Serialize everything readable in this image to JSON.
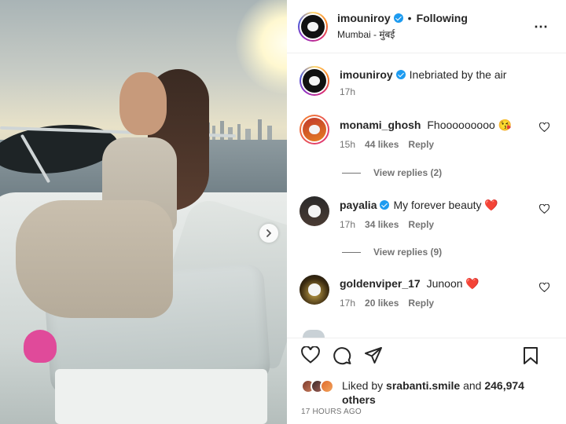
{
  "post": {
    "username": "imouniroy",
    "follow_status": "Following",
    "separator": "•",
    "location": "Mumbai - मुंबई",
    "more_icon": "⋯"
  },
  "caption": {
    "username": "imouniroy",
    "text": "Inebriated by the air",
    "time": "17h"
  },
  "comments": [
    {
      "username": "monami_ghosh",
      "text": "Fhooooooooo 😘",
      "time": "15h",
      "likes": "44 likes",
      "reply_label": "Reply",
      "view_replies": "View replies (2)"
    },
    {
      "username": "payalia",
      "text": "My forever beauty ❤️",
      "time": "17h",
      "likes": "34 likes",
      "reply_label": "Reply",
      "view_replies": "View replies (9)"
    },
    {
      "username": "goldenviper_17",
      "text": "Junoon ❤️",
      "time": "17h",
      "likes": "20 likes",
      "reply_label": "Reply"
    }
  ],
  "likes": {
    "prefix": "Liked by",
    "user": "srabanti.smile",
    "middle": "and",
    "count": "246,974",
    "suffix": "others"
  },
  "posted": "17 HOURS AGO",
  "colors": {
    "verified": "#1d9bf0",
    "heart": "#e0245e",
    "muted": "#737373"
  },
  "icons": [
    "heart-icon",
    "comment-icon",
    "share-icon",
    "bookmark-icon",
    "chevron-right-icon",
    "more-icon"
  ]
}
